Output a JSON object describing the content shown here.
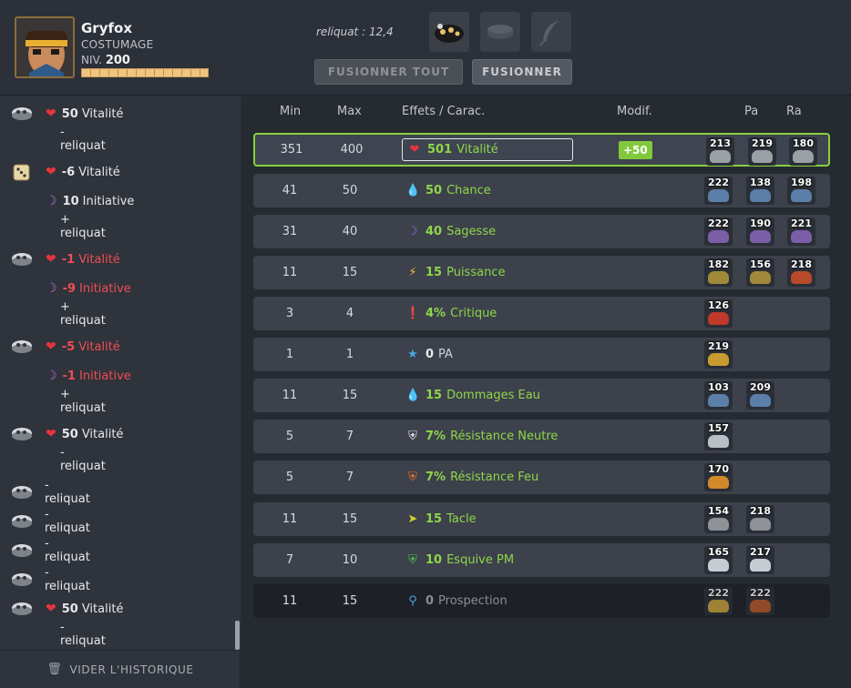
{
  "character": {
    "name": "Gryfox",
    "subtitle": "COSTUMAGE",
    "level_label": "NIV.",
    "level": "200"
  },
  "reliquat_label": "reliquat : 12,4",
  "buttons": {
    "fusionner_tout": "FUSIONNER TOUT",
    "fusionner": "FUSIONNER"
  },
  "history": {
    "clear_label": "VIDER L'HISTORIQUE",
    "rows": [
      {
        "icon": "rune-icon",
        "stat_icon": "heart-icon",
        "value": "50",
        "label": "Vitalité",
        "negative": false
      },
      {
        "icon": "",
        "stat_icon": "",
        "value": "",
        "label": "- reliquat",
        "negative": false
      },
      {
        "icon": "dice-icon",
        "stat_icon": "heart-icon",
        "value": "-6",
        "label": "Vitalité",
        "negative": false
      },
      {
        "icon": "",
        "stat_icon": "initiative-icon",
        "value": "10",
        "label": "Initiative",
        "negative": false
      },
      {
        "icon": "",
        "stat_icon": "",
        "value": "",
        "label": "+ reliquat",
        "negative": false
      },
      {
        "icon": "rune-icon",
        "stat_icon": "heart-icon",
        "value": "-1",
        "label": "Vitalité",
        "negative": true
      },
      {
        "icon": "",
        "stat_icon": "initiative-icon",
        "value": "-9",
        "label": "Initiative",
        "negative": true
      },
      {
        "icon": "",
        "stat_icon": "",
        "value": "",
        "label": "+ reliquat",
        "negative": false
      },
      {
        "icon": "rune-icon",
        "stat_icon": "heart-icon",
        "value": "-5",
        "label": "Vitalité",
        "negative": true
      },
      {
        "icon": "",
        "stat_icon": "initiative-icon",
        "value": "-1",
        "label": "Initiative",
        "negative": true
      },
      {
        "icon": "",
        "stat_icon": "",
        "value": "",
        "label": "+ reliquat",
        "negative": false
      },
      {
        "icon": "rune-icon",
        "stat_icon": "heart-icon",
        "value": "50",
        "label": "Vitalité",
        "negative": false
      },
      {
        "icon": "",
        "stat_icon": "",
        "value": "",
        "label": "- reliquat",
        "negative": false
      },
      {
        "icon": "rune-icon",
        "stat_icon": "",
        "value": "",
        "label": "- reliquat",
        "negative": false
      },
      {
        "icon": "rune-icon",
        "stat_icon": "",
        "value": "",
        "label": "- reliquat",
        "negative": false
      },
      {
        "icon": "rune-icon",
        "stat_icon": "",
        "value": "",
        "label": "- reliquat",
        "negative": false
      },
      {
        "icon": "rune-icon",
        "stat_icon": "",
        "value": "",
        "label": "- reliquat",
        "negative": false
      },
      {
        "icon": "rune-icon",
        "stat_icon": "heart-icon",
        "value": "50",
        "label": "Vitalité",
        "negative": false
      },
      {
        "icon": "",
        "stat_icon": "",
        "value": "",
        "label": "- reliquat",
        "negative": false
      }
    ]
  },
  "table": {
    "headers": {
      "min": "Min",
      "max": "Max",
      "effects": "Effets / Carac.",
      "modif": "Modif.",
      "pa": "Pa",
      "ra": "Ra"
    },
    "rows": [
      {
        "min": "351",
        "max": "400",
        "icon": "heart-icon",
        "value": "501",
        "label": "Vitalité",
        "modif": "+50",
        "runes": [
          "213",
          "219",
          "180"
        ],
        "selected": true,
        "dim": false,
        "color": "green"
      },
      {
        "min": "41",
        "max": "50",
        "icon": "water-drop-icon",
        "value": "50",
        "label": "Chance",
        "modif": "",
        "runes": [
          "222",
          "138",
          "198"
        ],
        "selected": false,
        "dim": false,
        "color": "green"
      },
      {
        "min": "31",
        "max": "40",
        "icon": "moon-icon",
        "value": "40",
        "label": "Sagesse",
        "modif": "",
        "runes": [
          "222",
          "190",
          "221"
        ],
        "selected": false,
        "dim": false,
        "color": "green"
      },
      {
        "min": "11",
        "max": "15",
        "icon": "lightning-icon",
        "value": "15",
        "label": "Puissance",
        "modif": "",
        "runes": [
          "182",
          "156",
          "218"
        ],
        "selected": false,
        "dim": false,
        "color": "green"
      },
      {
        "min": "3",
        "max": "4",
        "icon": "exclamation-icon",
        "value": "4%",
        "label": "Critique",
        "modif": "",
        "runes": [
          "126"
        ],
        "selected": false,
        "dim": false,
        "color": "green"
      },
      {
        "min": "1",
        "max": "1",
        "icon": "star-icon",
        "value": "0",
        "label": "PA",
        "modif": "",
        "runes": [
          "219"
        ],
        "selected": false,
        "dim": false,
        "color": "white"
      },
      {
        "min": "11",
        "max": "15",
        "icon": "water-drop-icon",
        "value": "15",
        "label": "Dommages Eau",
        "modif": "",
        "runes": [
          "103",
          "209"
        ],
        "selected": false,
        "dim": false,
        "color": "green"
      },
      {
        "min": "5",
        "max": "7",
        "icon": "shield-neutral-icon",
        "value": "7%",
        "label": "Résistance Neutre",
        "modif": "",
        "runes": [
          "157"
        ],
        "selected": false,
        "dim": false,
        "color": "green"
      },
      {
        "min": "5",
        "max": "7",
        "icon": "shield-fire-icon",
        "value": "7%",
        "label": "Résistance Feu",
        "modif": "",
        "runes": [
          "170"
        ],
        "selected": false,
        "dim": false,
        "color": "green"
      },
      {
        "min": "11",
        "max": "15",
        "icon": "tackle-icon",
        "value": "15",
        "label": "Tacle",
        "modif": "",
        "runes": [
          "154",
          "218"
        ],
        "selected": false,
        "dim": false,
        "color": "green"
      },
      {
        "min": "7",
        "max": "10",
        "icon": "shield-green-icon",
        "value": "10",
        "label": "Esquive PM",
        "modif": "",
        "runes": [
          "165",
          "217"
        ],
        "selected": false,
        "dim": false,
        "color": "green"
      },
      {
        "min": "11",
        "max": "15",
        "icon": "magnifier-icon",
        "value": "0",
        "label": "Prospection",
        "modif": "",
        "runes": [
          "222",
          "222"
        ],
        "selected": false,
        "dim": true,
        "color": "white"
      }
    ]
  },
  "colors": {
    "accent_green": "#86d13e",
    "negative_red": "#ef4e54",
    "heart": "#e4353f"
  }
}
